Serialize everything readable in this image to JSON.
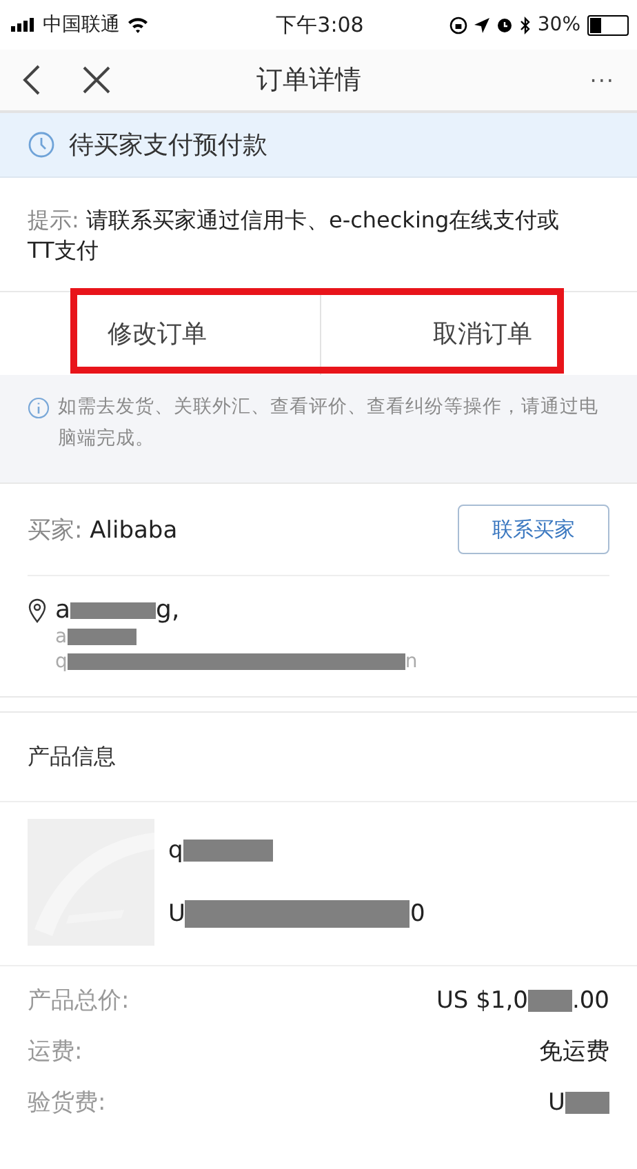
{
  "status_bar": {
    "carrier": "中国联通",
    "time": "下午3:08",
    "battery_text": "30%"
  },
  "nav": {
    "title": "订单详情",
    "more": "···"
  },
  "status_banner": {
    "text": "待买家支付预付款"
  },
  "tip": {
    "label": "提示:",
    "text": "请联系买家通过信用卡、e-checking在线支付或TT支付"
  },
  "actions": [
    {
      "label": "修改订单"
    },
    {
      "label": "取消订单"
    }
  ],
  "highlight": {
    "on": true
  },
  "info_note": "如需去发货、关联外汇、查看评价、查看纠纷等操作，请通过电脑端完成。",
  "buyer": {
    "label": "买家:",
    "name": "Alibaba",
    "contact_button": "联系买家"
  },
  "address": [
    {
      "kind": "main",
      "start": "a",
      "end": "g,"
    },
    {
      "kind": "sub",
      "start": "a"
    },
    {
      "kind": "sub",
      "start": "q",
      "end": "n"
    }
  ],
  "product_section": {
    "title": "产品信息",
    "product": {
      "kind": "picture",
      "name_start": "q",
      "price_start": "U",
      "price_end": "0"
    }
  },
  "costs": [
    {
      "label": "产品总价:",
      "start": "US $1,0",
      "end": ".00",
      "redacted": true
    },
    {
      "label": "运费:",
      "start": "免运费",
      "redacted": false
    },
    {
      "label": "验货费:",
      "start": "U",
      "redacted": true
    }
  ]
}
